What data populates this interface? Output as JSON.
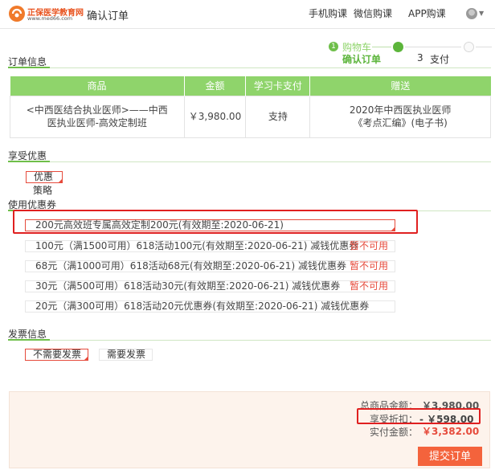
{
  "header": {
    "logo_name": "正保医学教育网",
    "logo_url": "www.med66.com",
    "page_title": "确认订单",
    "nav": [
      "手机购课",
      "微信购课",
      "APP购课"
    ]
  },
  "stepper": {
    "step1_num": "1",
    "step1_label": "购物车",
    "step2_label": "确认订单",
    "step3_num": "3",
    "step3_label": "支付"
  },
  "order_info": {
    "title": "订单信息",
    "columns": [
      "商品",
      "金额",
      "学习卡支付",
      "赠送"
    ],
    "row": {
      "product": "<中西医结合执业医师>——中西医执业医师-高效定制班",
      "amount": "￥3,980.00",
      "card_pay": "支持",
      "gift": "2020年中西医执业医师《考点汇编》(电子书)"
    }
  },
  "discount": {
    "title": "享受优惠",
    "option_line1": "优惠",
    "option_line2": "策略"
  },
  "coupons": {
    "title": "使用优惠券",
    "items": [
      {
        "text": "200元高效班专属高效定制200元(有效期至:2020-06-21)",
        "status": ""
      },
      {
        "text": "100元（满1500可用）618活动100元(有效期至:2020-06-21) 减钱优惠券",
        "status": "暂不可用"
      },
      {
        "text": "68元（满1000可用）618活动68元(有效期至:2020-06-21) 减钱优惠券",
        "status": "暂不可用"
      },
      {
        "text": "30元（满500可用）618活动30元(有效期至:2020-06-21) 减钱优惠券",
        "status": "暂不可用"
      },
      {
        "text": "20元（满300可用）618活动20元优惠券(有效期至:2020-06-21) 减钱优惠券",
        "status": ""
      }
    ]
  },
  "invoice": {
    "title": "发票信息",
    "options": [
      "不需要发票",
      "需要发票"
    ]
  },
  "summary": {
    "total_label": "总商品金额：",
    "total_value": "￥3,980.00",
    "discount_label": "享受折扣：",
    "discount_value": "- ￥598.00",
    "pay_label": "实付金额：",
    "pay_value": "￥3,382.00",
    "submit": "提交订单"
  },
  "colors": {
    "green": "#8fd46b",
    "accent_red": "#e64b3c",
    "button": "#f4633c",
    "summary_bg": "#fdf3ec"
  }
}
